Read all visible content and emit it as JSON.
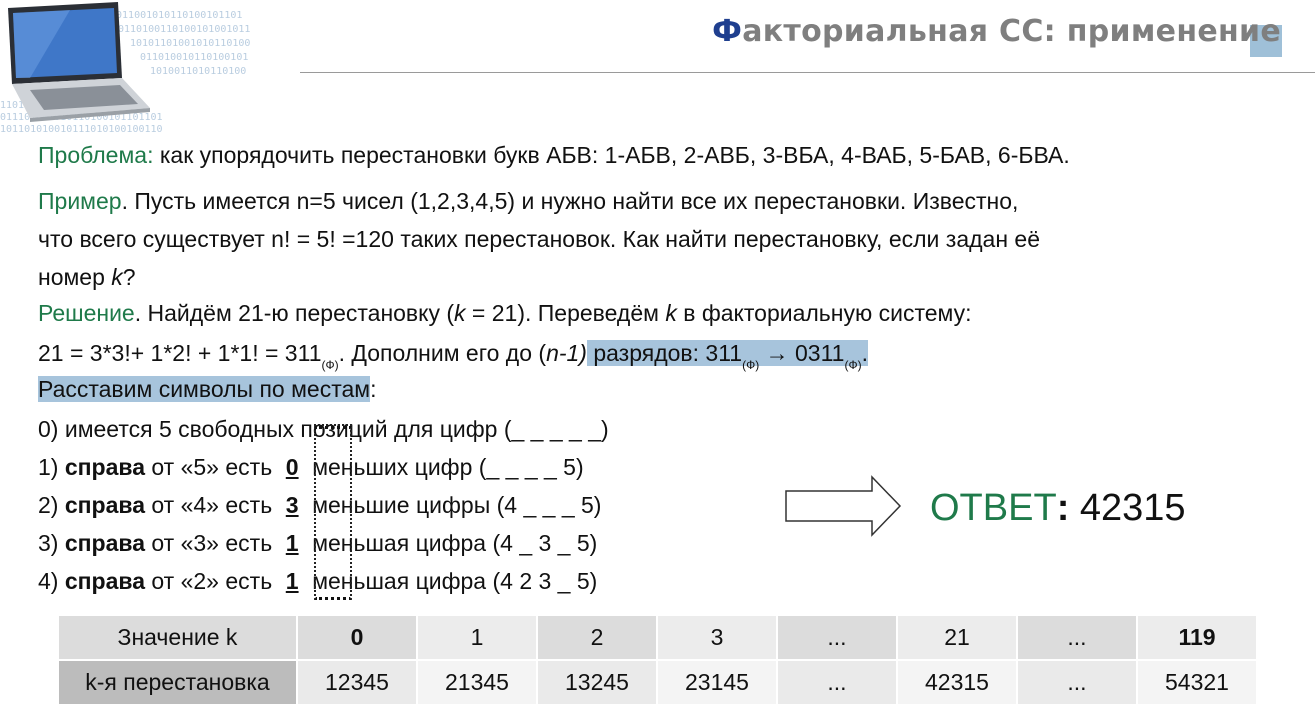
{
  "title": {
    "first_letter": "Ф",
    "rest": "акториальная СС: применение"
  },
  "problem": {
    "label": "Проблема:",
    "text": " как упорядочить перестановки букв АБВ: 1-АБВ, 2-АВБ, 3-ВБА, 4-ВАБ, 5-БАВ, 6-БВА."
  },
  "example": {
    "label": "Пример",
    "dot": ".",
    "line1": " Пусть имеется n=5 чисел (1,2,3,4,5) и нужно найти все их перестановки.  Известно,",
    "line2": "что всего существует n! = 5! =120 таких перестановок. Как найти перестановку, если задан её",
    "line3a": "номер ",
    "line3k": "k",
    "line3b": "?"
  },
  "solution": {
    "label": "Решение",
    "dot": ".",
    "t1": " Найдём 21-ю перестановку (",
    "k1": "k",
    "t2": " = 21). Переведём ",
    "k2": "k",
    "t3": " в факториальную систему:"
  },
  "formula": {
    "a": "21 = 3*3!+ 1*2! + 1*1! = 311",
    "sub1": "(Ф)",
    "b": ". Дополним его до (",
    "n1": "n-1)",
    "c": " разрядов: 311",
    "sub2": "(Ф)",
    "d": " → 0311",
    "sub3": "(Ф)",
    "e": "."
  },
  "arrange": {
    "text": "Расставим символы по местам",
    "colon": ":"
  },
  "steps": [
    {
      "num": "0)",
      "text": " имеется 5 свободных позиций для цифр (_ _ _ _ _)"
    },
    {
      "num": "1)",
      "bold": "справа",
      "pre": " от «5» есть",
      "digit": "0",
      "post": "меньших цифр    (_ _ _ _ 5)"
    },
    {
      "num": "2)",
      "bold": "справа",
      "pre": " от «4» есть",
      "digit": "3",
      "post": "меньшие цифры (4 _ _ _ 5)"
    },
    {
      "num": "3)",
      "bold": "справа",
      "pre": " от «3» есть",
      "digit": "1",
      "post": "меньшая цифра  (4 _ 3 _ 5)"
    },
    {
      "num": "4)",
      "bold": "справа",
      "pre": " от «2» есть",
      "digit": "1",
      "post": "меньшая цифра  (4 2 3 _ 5)"
    }
  ],
  "answer": {
    "label": "ОТВЕТ",
    "colon": ":",
    "value": " 42315"
  },
  "table": {
    "row1": [
      "Значение k",
      "0",
      "1",
      "2",
      "3",
      "...",
      "21",
      "...",
      "119"
    ],
    "row2": [
      "k-я перестановка",
      "12345",
      "21345",
      "13245",
      "23145",
      "...",
      "42315",
      "...",
      "54321"
    ]
  },
  "colors": {
    "title_accent": "#1f3f8f",
    "label_green": "#1f7a4a",
    "highlight_blue": "#a7c4dc"
  }
}
